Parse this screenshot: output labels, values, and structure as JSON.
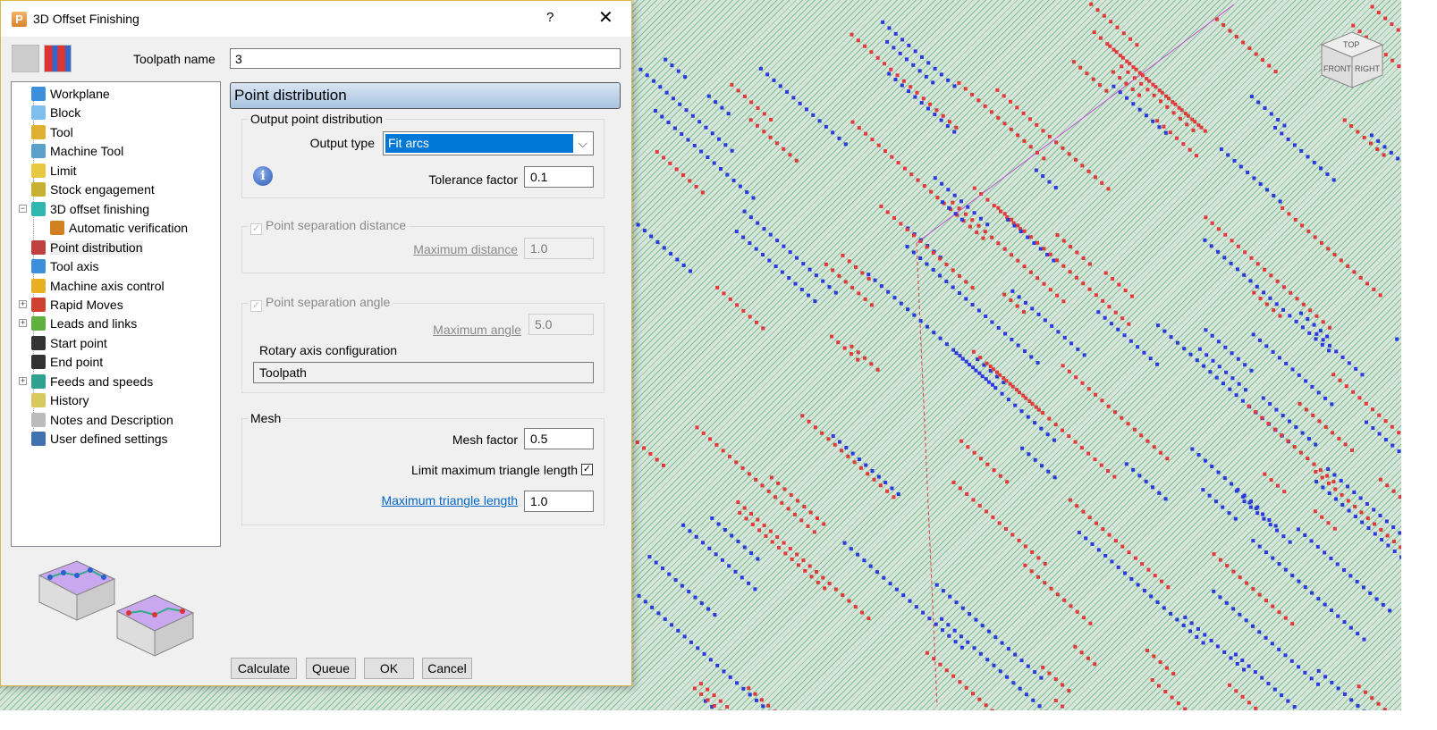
{
  "dialog": {
    "title": "3D Offset Finishing",
    "help": "?",
    "close": "✕",
    "app_icon": "P"
  },
  "toolpath": {
    "label": "Toolpath name",
    "value": "3"
  },
  "tree": [
    {
      "label": "Workplane",
      "icon": "workplane-icon",
      "color": "#3c8fdc"
    },
    {
      "label": "Block",
      "icon": "block-icon",
      "color": "#7fbfef"
    },
    {
      "label": "Tool",
      "icon": "tool-icon",
      "color": "#e0b030"
    },
    {
      "label": "Machine Tool",
      "icon": "machine-tool-icon",
      "color": "#5aa0c8"
    },
    {
      "label": "Limit",
      "icon": "limit-icon",
      "color": "#e8c840"
    },
    {
      "label": "Stock engagement",
      "icon": "stock-engagement-icon",
      "color": "#c8b030"
    },
    {
      "label": "3D offset finishing",
      "icon": "offset-finishing-icon",
      "color": "#2fb7b0"
    },
    {
      "label": "Automatic verification",
      "icon": "verification-icon",
      "color": "#d08020"
    },
    {
      "label": "Point distribution",
      "icon": "point-distribution-icon",
      "color": "#c04040"
    },
    {
      "label": "Tool axis",
      "icon": "tool-axis-icon",
      "color": "#3c8fdc"
    },
    {
      "label": "Machine axis control",
      "icon": "machine-axis-icon",
      "color": "#e8b020"
    },
    {
      "label": "Rapid Moves",
      "icon": "rapid-moves-icon",
      "color": "#d04030"
    },
    {
      "label": "Leads and links",
      "icon": "leads-links-icon",
      "color": "#60b040"
    },
    {
      "label": "Start point",
      "icon": "start-point-icon",
      "color": "#333"
    },
    {
      "label": "End point",
      "icon": "end-point-icon",
      "color": "#333"
    },
    {
      "label": "Feeds and speeds",
      "icon": "feeds-speeds-icon",
      "color": "#30a090"
    },
    {
      "label": "History",
      "icon": "history-icon",
      "color": "#d8c860"
    },
    {
      "label": "Notes and Description",
      "icon": "notes-icon",
      "color": "#bbb"
    },
    {
      "label": "User defined settings",
      "icon": "user-settings-icon",
      "color": "#4070b0"
    }
  ],
  "panel": {
    "title": "Point distribution"
  },
  "output": {
    "legend": "Output point distribution",
    "type_label": "Output type",
    "type_value": "Fit arcs",
    "tol_label": "Tolerance factor",
    "tol_value": "0.1"
  },
  "sep_dist": {
    "legend": "Point separation distance",
    "label": "Maximum distance",
    "value": "1.0",
    "checked": true
  },
  "sep_angle": {
    "legend": "Point separation angle",
    "label": "Maximum angle",
    "value": "5.0",
    "checked": true,
    "rotary_label": "Rotary axis configuration",
    "rotary_value": "Toolpath"
  },
  "mesh": {
    "legend": "Mesh",
    "factor_label": "Mesh factor",
    "factor_value": "0.5",
    "limit_label": "Limit maximum triangle length",
    "limit_checked": true,
    "max_label": "Maximum triangle length",
    "max_value": "1.0"
  },
  "buttons": {
    "calculate": "Calculate",
    "queue": "Queue",
    "ok": "OK",
    "cancel": "Cancel"
  },
  "viewcube": {
    "top": "TOP",
    "front": "FRONT",
    "right": "RIGHT"
  },
  "colors": {
    "accent": "#0078d7",
    "red_points": "#e03a3a",
    "blue_points": "#2a3adc"
  }
}
